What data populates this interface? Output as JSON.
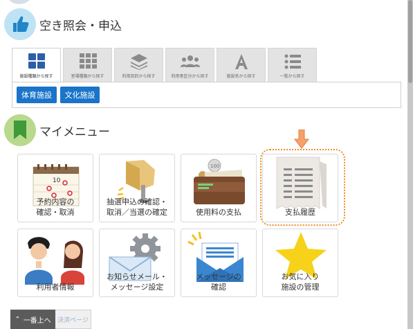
{
  "sections": {
    "vacancy_title": "空き照会・申込",
    "mymenu_title": "マイメニュー"
  },
  "tabs": [
    {
      "label": "施設種類から探す",
      "icon": "grid-icon",
      "active": true
    },
    {
      "label": "室場種類から探す",
      "icon": "grid9-icon",
      "active": false
    },
    {
      "label": "利用目的から探す",
      "icon": "layers-icon",
      "active": false
    },
    {
      "label": "利用者区分から探す",
      "icon": "users-icon",
      "active": false
    },
    {
      "label": "施設名から探す",
      "icon": "letter-a-icon",
      "active": false
    },
    {
      "label": "一覧から探す",
      "icon": "list-icon",
      "active": false
    }
  ],
  "facility_buttons": [
    "体育施設",
    "文化施設"
  ],
  "menu": [
    {
      "label": "予約内容の\n確認・取消",
      "icon": "calendar-icon"
    },
    {
      "label": "抽選申込の確認・\n取消／当選の確定",
      "icon": "lottery-icon"
    },
    {
      "label": "使用料の支払",
      "icon": "wallet-icon"
    },
    {
      "label": "支払履歴",
      "icon": "receipt-icon",
      "highlighted": true
    },
    {
      "label": "利用者情報",
      "icon": "people-icon"
    },
    {
      "label": "お知らせメール・\nメッセージ設定",
      "icon": "mail-gear-icon"
    },
    {
      "label": "メッセージの\n確認",
      "icon": "envelope-icon"
    },
    {
      "label": "お気に入り\n施設の管理",
      "icon": "star-icon"
    }
  ],
  "footer": {
    "to_top": "一番上へ",
    "link": "決済ページ"
  },
  "colors": {
    "accent": "#1a74c9",
    "highlight": "#f08a24",
    "vacancy_badge": "#bfe3f4",
    "mymenu_badge": "#b9d98d"
  }
}
